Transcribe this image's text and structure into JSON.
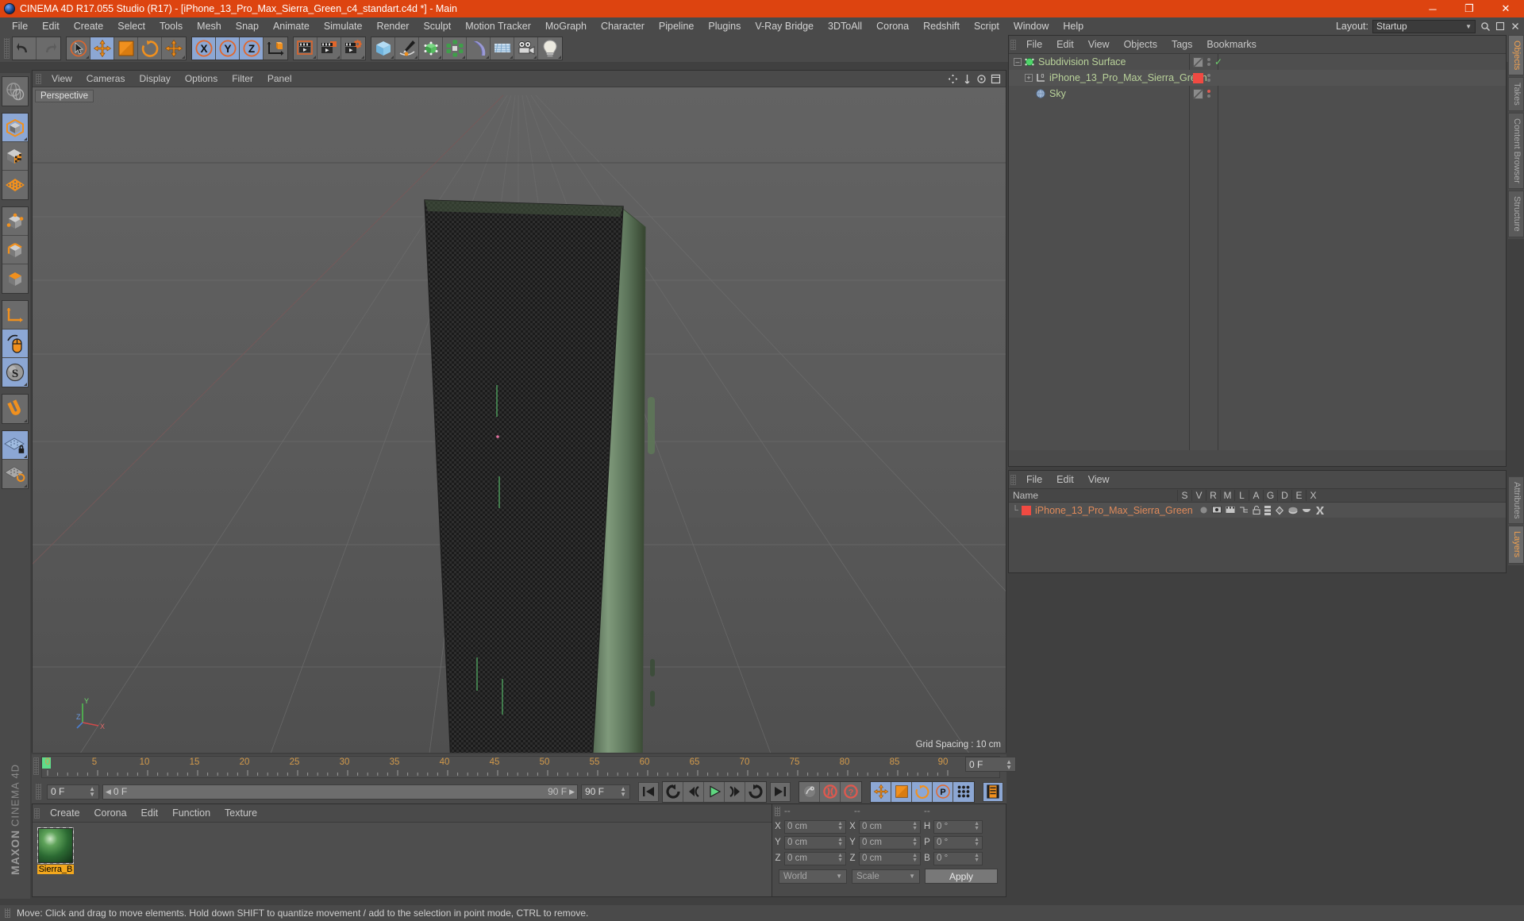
{
  "titlebar": {
    "title": "CINEMA 4D R17.055 Studio (R17) - [iPhone_13_Pro_Max_Sierra_Green_c4_standart.c4d *] - Main",
    "minimize": "─",
    "maximize": "❐",
    "close": "✕",
    "app_icon": "cinema4d-logo-icon"
  },
  "menubar": {
    "items": [
      {
        "label": "File"
      },
      {
        "label": "Edit"
      },
      {
        "label": "Create"
      },
      {
        "label": "Select"
      },
      {
        "label": "Tools"
      },
      {
        "label": "Mesh"
      },
      {
        "label": "Snap"
      },
      {
        "label": "Animate"
      },
      {
        "label": "Simulate"
      },
      {
        "label": "Render"
      },
      {
        "label": "Sculpt"
      },
      {
        "label": "Motion Tracker"
      },
      {
        "label": "MoGraph"
      },
      {
        "label": "Character"
      },
      {
        "label": "Pipeline"
      },
      {
        "label": "Plugins"
      },
      {
        "label": "V-Ray Bridge"
      },
      {
        "label": "3DToAll"
      },
      {
        "label": "Corona"
      },
      {
        "label": "Redshift"
      },
      {
        "label": "Script"
      },
      {
        "label": "Window"
      },
      {
        "label": "Help"
      }
    ],
    "layout_label": "Layout:",
    "layout_value": "Startup",
    "caret": "▼"
  },
  "toolbar": {
    "groups": [
      {
        "buttons": [
          {
            "name": "undo-button",
            "icon": "undo-arrow-icon",
            "selected": false,
            "corner": false
          },
          {
            "name": "redo-button",
            "icon": "redo-arrow-icon",
            "selected": false,
            "corner": false
          }
        ]
      },
      {
        "buttons": [
          {
            "name": "live-selection-tool",
            "icon": "cursor-circle-icon",
            "selected": false,
            "corner": true
          },
          {
            "name": "move-tool",
            "icon": "move-arrows-icon",
            "selected": true,
            "corner": false
          },
          {
            "name": "scale-tool",
            "icon": "scale-box-icon",
            "selected": false,
            "corner": false
          },
          {
            "name": "rotate-tool",
            "icon": "rotate-arc-icon",
            "selected": false,
            "corner": false
          },
          {
            "name": "dynamic-place-tool",
            "icon": "move-arrows-icon",
            "selected": false,
            "corner": true
          }
        ]
      },
      {
        "buttons": [
          {
            "name": "lock-x-axis",
            "icon": "axis-x-icon",
            "selected": true,
            "corner": false
          },
          {
            "name": "lock-y-axis",
            "icon": "axis-y-icon",
            "selected": true,
            "corner": false
          },
          {
            "name": "lock-z-axis",
            "icon": "axis-z-icon",
            "selected": true,
            "corner": false
          },
          {
            "name": "world-object-coordinates",
            "icon": "world-axis-cube-icon",
            "selected": false,
            "corner": false
          }
        ]
      },
      {
        "buttons": [
          {
            "name": "render-view-button",
            "icon": "render-clapper-icon",
            "selected": false,
            "corner": true
          },
          {
            "name": "render-region-button",
            "icon": "render-region-icon",
            "selected": false,
            "corner": true
          },
          {
            "name": "render-settings-button",
            "icon": "render-settings-gear-icon",
            "selected": false,
            "corner": true
          }
        ]
      },
      {
        "buttons": [
          {
            "name": "add-cube-object",
            "icon": "cube-blue-icon",
            "selected": false,
            "corner": true
          },
          {
            "name": "add-spline-object",
            "icon": "pen-spline-icon",
            "selected": false,
            "corner": true
          },
          {
            "name": "add-nurbs-object",
            "icon": "hyper-nurbs-green-icon",
            "selected": false,
            "corner": true
          },
          {
            "name": "add-array-object",
            "icon": "array-cluster-icon",
            "selected": false,
            "corner": true
          },
          {
            "name": "add-bend-deformer",
            "icon": "bend-deformer-icon",
            "selected": false,
            "corner": true
          },
          {
            "name": "add-floor-object",
            "icon": "floor-grid-icon",
            "selected": false,
            "corner": true
          },
          {
            "name": "add-camera-object",
            "icon": "camera-icon",
            "selected": false,
            "corner": true
          },
          {
            "name": "add-light-object",
            "icon": "light-bulb-icon",
            "selected": false,
            "corner": true
          }
        ]
      }
    ]
  },
  "left_toolbar": {
    "groups": [
      {
        "buttons": [
          {
            "name": "undo-view-button",
            "icon": "globe-wire-icon",
            "selected": false,
            "corner": false
          }
        ]
      },
      {
        "buttons": [
          {
            "name": "model-mode",
            "icon": "model-cube-icon",
            "selected": true,
            "corner": true
          },
          {
            "name": "texture-mode",
            "icon": "texture-checker-cube-icon",
            "selected": false,
            "corner": false
          },
          {
            "name": "workplane-mode",
            "icon": "workplane-grid-icon",
            "selected": false,
            "corner": false
          }
        ]
      },
      {
        "buttons": [
          {
            "name": "points-mode",
            "icon": "points-cube-icon",
            "selected": false,
            "corner": false
          },
          {
            "name": "edges-mode",
            "icon": "edges-cube-icon",
            "selected": false,
            "corner": false
          },
          {
            "name": "polygons-mode",
            "icon": "polygons-cube-icon",
            "selected": false,
            "corner": false
          }
        ]
      },
      {
        "buttons": [
          {
            "name": "enable-axis-modification",
            "icon": "axis-l-icon",
            "selected": false,
            "corner": false
          },
          {
            "name": "viewport-solo-single",
            "icon": "mouse-icon",
            "selected": true,
            "corner": false
          },
          {
            "name": "soft-selection",
            "icon": "s-sphere-icon",
            "selected": true,
            "corner": true
          }
        ]
      },
      {
        "buttons": [
          {
            "name": "enable-snapping",
            "icon": "magnet-icon",
            "selected": false,
            "corner": true
          }
        ]
      },
      {
        "buttons": [
          {
            "name": "lock-workplane",
            "icon": "grid-lock-icon",
            "selected": true,
            "corner": true
          },
          {
            "name": "planar-workplane",
            "icon": "grid-rotate-icon",
            "selected": false,
            "corner": true
          }
        ]
      }
    ],
    "brand_line1": "MAXON",
    "brand_line2": "CINEMA 4D"
  },
  "viewport": {
    "menus": [
      {
        "label": "View"
      },
      {
        "label": "Cameras"
      },
      {
        "label": "Display"
      },
      {
        "label": "Options"
      },
      {
        "label": "Filter"
      },
      {
        "label": "Panel"
      }
    ],
    "nav_icons": [
      "pan-icon",
      "zoom-icon",
      "dolly-icon",
      "maximize-view-icon"
    ],
    "perspective_label": "Perspective",
    "grid_spacing": "Grid Spacing : 10 cm",
    "axis_labels": {
      "x": "X",
      "y": "Y",
      "z": "Z"
    },
    "model_name": "iPhone 13 Pro Max Sierra Green"
  },
  "object_manager": {
    "menus": [
      {
        "label": "File"
      },
      {
        "label": "Edit"
      },
      {
        "label": "View"
      },
      {
        "label": "Objects"
      },
      {
        "label": "Tags"
      },
      {
        "label": "Bookmarks"
      }
    ],
    "rows": [
      {
        "name": "Subdivision Surface",
        "indent": 0,
        "icon": "subdivision-surface-icon",
        "expander": "-",
        "tag_type": "display-tag",
        "has_check": true,
        "dot_red": false
      },
      {
        "name": "iPhone_13_Pro_Max_Sierra_Green",
        "indent": 1,
        "icon": "null-object-icon",
        "expander": "+",
        "tag_type": "material-tag-red",
        "has_check": false,
        "dot_red": false
      },
      {
        "name": "Sky",
        "indent": 1,
        "icon": "sky-sphere-icon",
        "expander": "",
        "tag_type": "display-tag",
        "has_check": false,
        "dot_red": true
      }
    ]
  },
  "material_manager": {
    "menus": [
      {
        "label": "File"
      },
      {
        "label": "Edit"
      },
      {
        "label": "View"
      }
    ],
    "header_name": "Name",
    "columns": [
      "S",
      "V",
      "R",
      "M",
      "L",
      "A",
      "G",
      "D",
      "E",
      "X"
    ],
    "rows": [
      {
        "name": "iPhone_13_Pro_Max_Sierra_Green",
        "swatch": "#f04a42"
      }
    ]
  },
  "right_tabs": {
    "top": [
      {
        "label": "Objects",
        "active": true
      },
      {
        "label": "Takes",
        "active": false
      },
      {
        "label": "Content Browser",
        "active": false
      },
      {
        "label": "Structure",
        "active": false
      }
    ],
    "bottom": [
      {
        "label": "Attributes",
        "active": false
      },
      {
        "label": "Layers",
        "active": true
      }
    ]
  },
  "timeline": {
    "ticks": [
      0,
      5,
      10,
      15,
      20,
      25,
      30,
      35,
      40,
      45,
      50,
      55,
      60,
      65,
      70,
      75,
      80,
      85,
      90
    ],
    "current_frame_marker": 0,
    "end_frame_field": "0 F"
  },
  "transport": {
    "current_frame": "0 F",
    "range_start": "0 F",
    "range_end": "90 F",
    "max_frames": "90 F",
    "buttons": [
      {
        "name": "go-to-start-button",
        "icon": "skip-start-icon",
        "selected": false
      },
      {
        "name": "play-backwards-loop-button",
        "icon": "loop-back-icon",
        "selected": false
      },
      {
        "name": "step-back-button",
        "icon": "step-back-icon",
        "selected": false
      },
      {
        "name": "play-button",
        "icon": "play-triangle-icon",
        "selected": false
      },
      {
        "name": "step-forward-button",
        "icon": "step-forward-icon",
        "selected": false
      },
      {
        "name": "loop-forward-button",
        "icon": "loop-forward-icon",
        "selected": false
      },
      {
        "name": "go-to-end-button",
        "icon": "skip-end-icon",
        "selected": false
      },
      {
        "name": "autokeying-button",
        "icon": "key-disabled-icon",
        "selected": false
      },
      {
        "name": "record-active-objects-button",
        "icon": "record-red-icon",
        "selected": false
      },
      {
        "name": "auto-keyframing-button",
        "icon": "question-red-icon",
        "selected": false
      },
      {
        "name": "key-position-button",
        "icon": "move-arrows-icon",
        "selected": true
      },
      {
        "name": "key-scale-button",
        "icon": "scale-box-icon",
        "selected": true
      },
      {
        "name": "key-rotation-button",
        "icon": "rotate-arc-icon",
        "selected": true
      },
      {
        "name": "key-parameter-button",
        "icon": "p-circle-icon",
        "selected": true
      },
      {
        "name": "key-point-level-button",
        "icon": "pla-dots-icon",
        "selected": true
      },
      {
        "name": "timeline-view-button",
        "icon": "timeline-strip-icon",
        "selected": true
      }
    ]
  },
  "material_browser": {
    "menus": [
      {
        "label": "Create"
      },
      {
        "label": "Corona"
      },
      {
        "label": "Edit"
      },
      {
        "label": "Function"
      },
      {
        "label": "Texture"
      }
    ],
    "materials": [
      {
        "label": "Sierra_B",
        "preview": "green-glossy-sphere"
      }
    ]
  },
  "coordinates": {
    "headers": [
      "--",
      "--",
      "--"
    ],
    "rows": [
      {
        "l1": "X",
        "v1": "0 cm",
        "l2": "X",
        "v2": "0 cm",
        "l3": "H",
        "v3": "0 °"
      },
      {
        "l1": "Y",
        "v1": "0 cm",
        "l2": "Y",
        "v2": "0 cm",
        "l3": "P",
        "v3": "0 °"
      },
      {
        "l1": "Z",
        "v1": "0 cm",
        "l2": "Z",
        "v2": "0 cm",
        "l3": "B",
        "v3": "0 °"
      }
    ],
    "space_select": "World",
    "mode_select": "Scale",
    "apply_label": "Apply",
    "caret": "▼"
  },
  "statusbar": {
    "message": "Move: Click and drag to move elements. Hold down SHIFT to quantize movement / add to the selection in point mode, CTRL to remove."
  },
  "colors": {
    "accent_orange": "#dd4410",
    "panel_bg": "#4a4a4a",
    "button_bg": "#6b6b6b",
    "selected_blue": "#8ca7d4",
    "icon_orange": "#f0901e",
    "phone_green": "#5d7a5c",
    "text": "#c8c8c8"
  }
}
